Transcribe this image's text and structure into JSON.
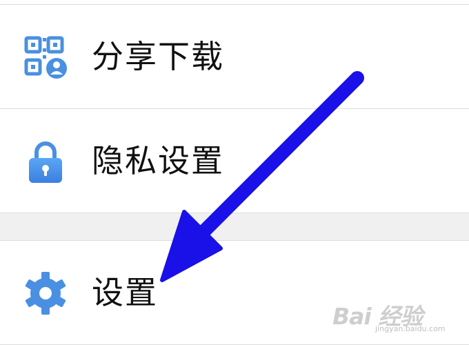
{
  "menu": {
    "items": [
      {
        "label": "分享下载",
        "icon": "qr-code-user-icon"
      },
      {
        "label": "隐私设置",
        "icon": "lock-icon"
      },
      {
        "label": "设置",
        "icon": "gear-icon"
      }
    ]
  },
  "overlay": {
    "annotation": "arrow-pointing-to-settings",
    "arrow_color": "#1a10e8"
  },
  "watermark": {
    "brand": "Bai 经验",
    "url": "jingyan.baidu.com"
  },
  "colors": {
    "icon_blue": "#4a90e2",
    "text": "#111111",
    "divider": "#dcdcdc",
    "section_gap": "#f0f0f0"
  }
}
